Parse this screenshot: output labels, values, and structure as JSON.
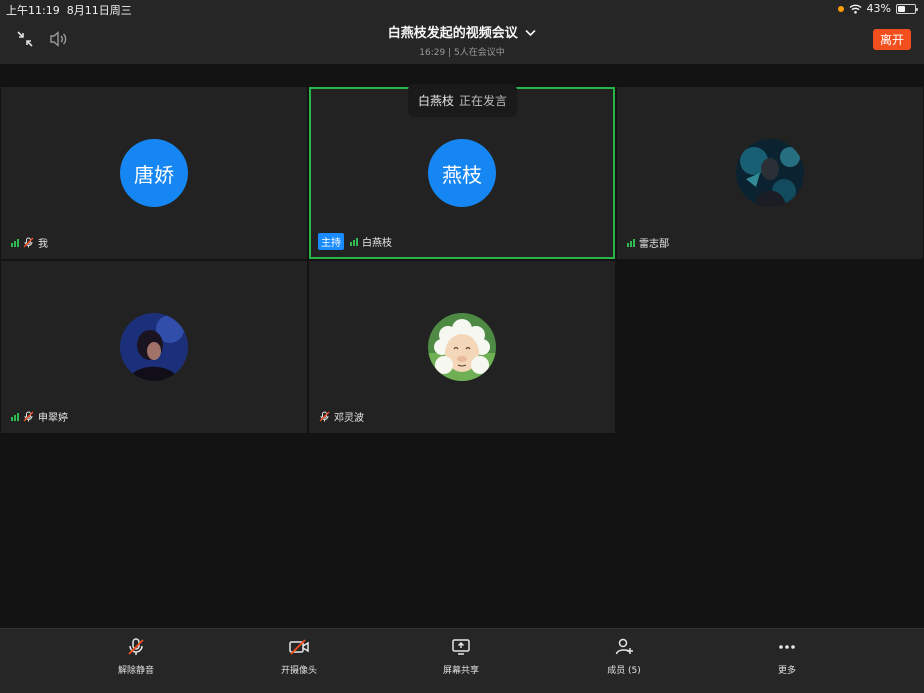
{
  "status_bar": {
    "time": "上午11:19",
    "date": "8月11日周三",
    "battery": "43%",
    "battery_level": 0.43
  },
  "header": {
    "title": "白燕枝发起的视频会议",
    "subtitle": "16:29 | 5人在会议中",
    "leave_label": "离开"
  },
  "speaker_toast": {
    "name": "白燕枝",
    "status": "正在发言"
  },
  "participants": [
    {
      "name": "我",
      "avatar_text": "唐娇",
      "avatar_type": "text",
      "signal": true,
      "muted": true,
      "host": false,
      "speaking": false
    },
    {
      "name": "白燕枝",
      "avatar_text": "燕枝",
      "avatar_type": "text",
      "signal": true,
      "muted": false,
      "host": true,
      "host_label": "主持",
      "speaking": true
    },
    {
      "name": "雷志郚",
      "avatar_type": "photo",
      "signal": true,
      "muted": false,
      "host": false,
      "speaking": false
    },
    {
      "name": "申翠婷",
      "avatar_type": "photo",
      "signal": true,
      "muted": true,
      "host": false,
      "speaking": false
    },
    {
      "name": "邓灵波",
      "avatar_type": "cartoon-sheep",
      "signal": false,
      "muted": true,
      "host": false,
      "speaking": false
    }
  ],
  "toolbar": [
    {
      "label": "解除静音",
      "icon": "mic-muted-icon"
    },
    {
      "label": "开摄像头",
      "icon": "camera-off-icon"
    },
    {
      "label": "屏幕共享",
      "icon": "screen-share-icon"
    },
    {
      "label": "成员 (5)",
      "icon": "members-add-icon"
    },
    {
      "label": "更多",
      "icon": "more-icon"
    }
  ],
  "colors": {
    "accent": "#1687f2",
    "leave": "#f24e1e",
    "speaking_border": "#27b54a",
    "signal": "#2dbb52"
  }
}
